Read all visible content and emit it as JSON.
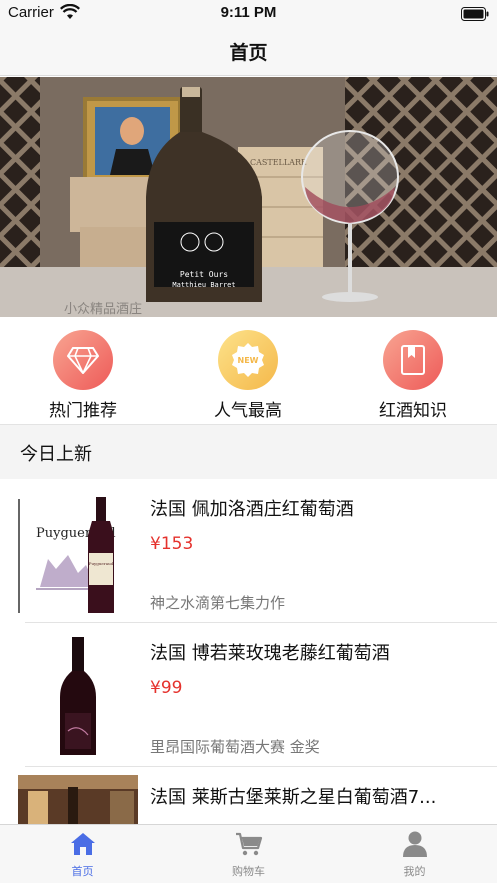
{
  "status": {
    "carrier": "Carrier",
    "time": "9:11 PM"
  },
  "nav": {
    "title": "首页"
  },
  "banner": {
    "bottle_label_line1": "Petit Ours",
    "bottle_label_line2": "Matthieu Barret",
    "watermark": "小众精品酒庄",
    "crate_text": "CASTELLARE"
  },
  "quick": [
    {
      "label": "热门推荐",
      "icon": "diamond-icon"
    },
    {
      "label": "人气最高",
      "icon": "new-badge-icon",
      "badge": "NEW"
    },
    {
      "label": "红酒知识",
      "icon": "book-icon"
    }
  ],
  "section": {
    "title": "今日上新"
  },
  "products": [
    {
      "name": "法国 佩加洛酒庄红葡萄酒",
      "price": "¥153",
      "desc": "神之水滴第七集力作",
      "image_text": "Puygueraud"
    },
    {
      "name": "法国 博若莱玫瑰老藤红葡萄酒",
      "price": "¥99",
      "desc": "里昂国际葡萄酒大赛 金奖"
    },
    {
      "name": "法国 莱斯古堡莱斯之星白葡萄酒7...",
      "price": "",
      "desc": ""
    }
  ],
  "tabs": [
    {
      "label": "首页",
      "icon": "home-icon",
      "active": true
    },
    {
      "label": "购物车",
      "icon": "cart-icon",
      "active": false
    },
    {
      "label": "我的",
      "icon": "person-icon",
      "active": false
    }
  ],
  "colors": {
    "accent": "#4a6de5",
    "price": "#e5322d",
    "icon_red": "#f0645a",
    "icon_yellow": "#f7c74a"
  }
}
